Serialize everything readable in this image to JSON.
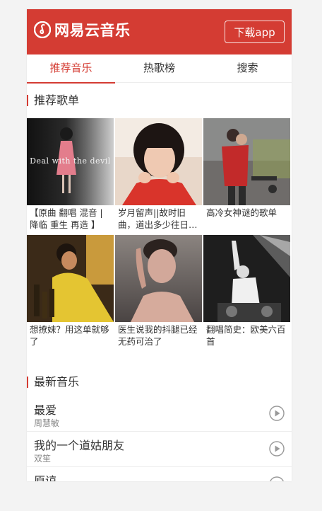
{
  "header": {
    "app_name": "网易云音乐",
    "download_button": "下载app",
    "brand_color": "#d43c33"
  },
  "tabs": [
    {
      "label": "推荐音乐",
      "active": true
    },
    {
      "label": "热歌榜",
      "active": false
    },
    {
      "label": "搜索",
      "active": false
    }
  ],
  "recommended": {
    "title": "推荐歌单",
    "playlists": [
      {
        "title": "【原曲 翻唱 混音 | 降临 重生 再造 】",
        "cover_text": "Deal with the devil"
      },
      {
        "title": "岁月留声||故时旧曲，道出多少往日情怀"
      },
      {
        "title": "高冷女神谜的歌单"
      },
      {
        "title": "想撩妹？用这单就够了"
      },
      {
        "title": "医生说我的抖腿已经无药可治了"
      },
      {
        "title": "翻唱简史：欧美六百首"
      }
    ]
  },
  "latest": {
    "title": "最新音乐",
    "songs": [
      {
        "title": "最爱",
        "artist": "周慧敏"
      },
      {
        "title": "我的一个道姑朋友",
        "artist": "双笙"
      },
      {
        "title": "原谅",
        "artist": ""
      }
    ]
  },
  "icons": {
    "logo": "netease-music-logo-icon",
    "play": "play-circle-icon"
  }
}
